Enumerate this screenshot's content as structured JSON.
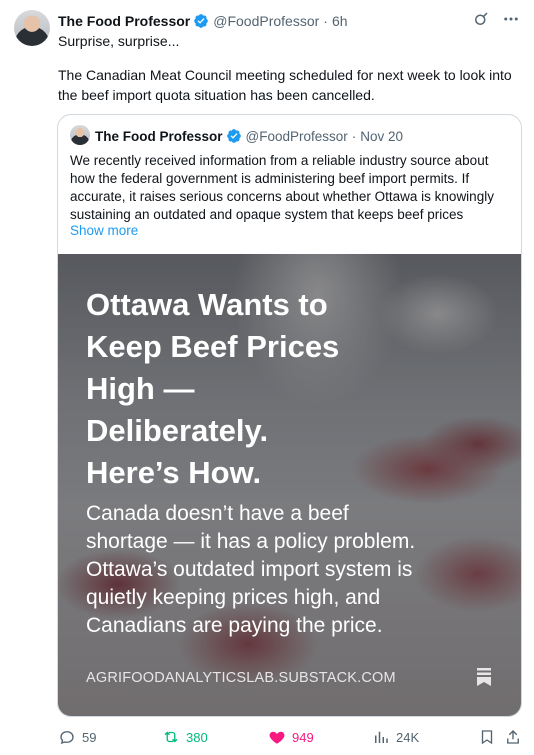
{
  "tweet": {
    "author_name": "The Food Professor",
    "handle": "@FoodProfessor",
    "time": "6h",
    "line1": "Surprise, surprise...",
    "line2": "The Canadian Meat Council meeting scheduled for next week to look into",
    "line3": "the beef import quota situation has been cancelled."
  },
  "quoted": {
    "author_name": "The Food Professor",
    "handle": "@FoodProfessor",
    "date": "Nov 20",
    "lines": [
      "We recently received information from a reliable industry source about",
      "how the federal government is administering beef import permits. If",
      "accurate, it raises serious concerns about whether Ottawa is knowingly",
      "sustaining an outdated and opaque system that keeps beef prices"
    ],
    "show_more": "Show more",
    "media": {
      "headline": [
        "Ottawa Wants to",
        "Keep Beef Prices",
        "High —",
        "Deliberately.",
        "Here’s How."
      ],
      "subline": [
        "Canada doesn’t have a beef",
        "shortage — it has a policy problem.",
        "Ottawa’s outdated import system is",
        "quietly keeping prices high, and",
        "Canadians are paying the price."
      ],
      "source": "AGRIFOODANALYTICSLAB.SUBSTACK.COM"
    }
  },
  "actions": {
    "replies": "59",
    "reposts": "380",
    "likes": "949",
    "views": "24K"
  },
  "colors": {
    "verified": "#1d9bf0",
    "repost": "#00ba7c",
    "like": "#f91880",
    "muted": "#536471"
  },
  "dot": "·"
}
